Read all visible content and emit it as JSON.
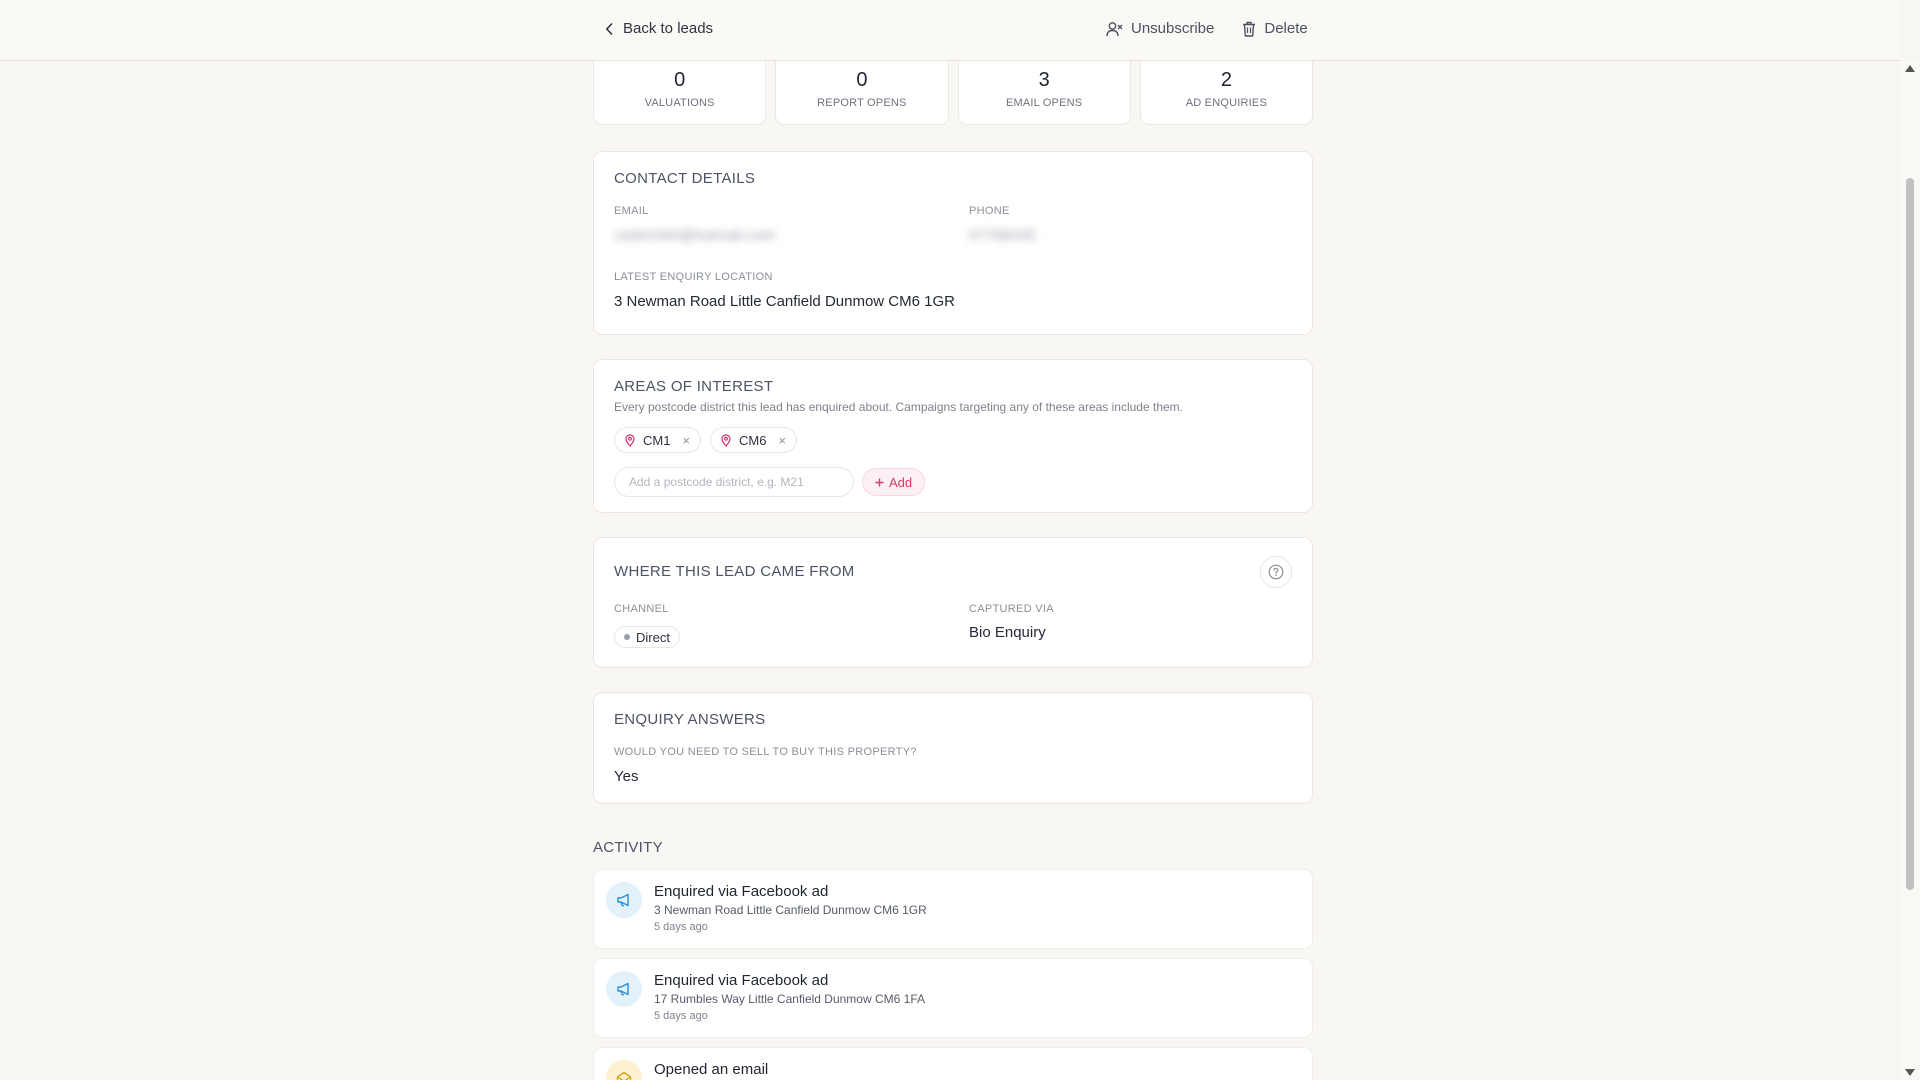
{
  "topbar": {
    "back_label": "Back to leads",
    "unsubscribe_label": "Unsubscribe",
    "delete_label": "Delete"
  },
  "stats": [
    {
      "value": "0",
      "label": "VALUATIONS"
    },
    {
      "value": "0",
      "label": "REPORT OPENS"
    },
    {
      "value": "3",
      "label": "EMAIL OPENS"
    },
    {
      "value": "2",
      "label": "AD ENQUIRIES"
    }
  ],
  "contact": {
    "title": "CONTACT DETAILS",
    "email_label": "EMAIL",
    "email_value": "cedrich84@hotmail.com",
    "phone_label": "PHONE",
    "phone_value": "07768435",
    "location_label": "LATEST ENQUIRY LOCATION",
    "location_value": "3 Newman Road Little Canfield Dunmow CM6 1GR"
  },
  "areas": {
    "title": "AREAS OF INTEREST",
    "description": "Every postcode district this lead has enquired about. Campaigns targeting any of these areas include them.",
    "chips": [
      "CM1",
      "CM6"
    ],
    "remove_glyph": "×",
    "input_placeholder": "Add a postcode district, e.g. M21",
    "add_label": "Add"
  },
  "source": {
    "title": "WHERE THIS LEAD CAME FROM",
    "channel_label": "CHANNEL",
    "channel_value": "Direct",
    "captured_label": "CAPTURED VIA",
    "captured_value": "Bio Enquiry"
  },
  "enquiry": {
    "title": "ENQUIRY ANSWERS",
    "question": "WOULD YOU NEED TO SELL TO BUY THIS PROPERTY?",
    "answer": "Yes"
  },
  "activity": {
    "title": "ACTIVITY",
    "items": [
      {
        "title": "Enquired via Facebook ad",
        "subtitle": "3 Newman Road Little Canfield Dunmow CM6 1GR",
        "time": "5 days ago",
        "icon": "megaphone-icon"
      },
      {
        "title": "Enquired via Facebook ad",
        "subtitle": "17 Rumbles Way Little Canfield Dunmow CM6 1FA",
        "time": "5 days ago",
        "icon": "megaphone-icon"
      },
      {
        "title": "Opened an email",
        "icon": "envelope-open-icon"
      }
    ]
  },
  "colors": {
    "accent": "#d63a6a",
    "background": "#f8f7f4",
    "activity_blue": "#e3f1fb",
    "activity_yellow": "#fdf1cf"
  }
}
